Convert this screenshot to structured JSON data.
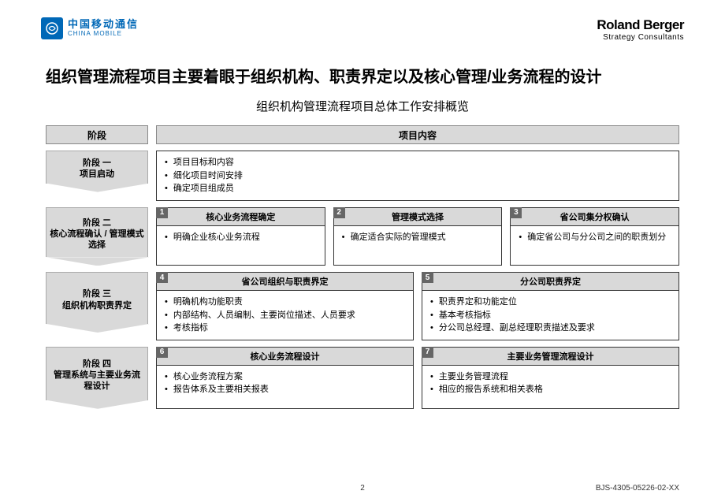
{
  "header": {
    "logo_cn": "中国移动通信",
    "logo_en": "CHINA MOBILE",
    "rb_name": "Roland Berger",
    "rb_sub": "Strategy Consultants"
  },
  "title": "组织管理流程项目主要着眼于组织机构、职责界定以及核心管理/业务流程的设计",
  "subtitle": "组织机构管理流程项目总体工作安排概览",
  "columns": {
    "phase": "阶段",
    "content": "项目内容"
  },
  "phases": [
    {
      "label": "阶段 一\n项目启动",
      "boxes": [
        {
          "num": "",
          "title": "",
          "items": [
            "项目目标和内容",
            "细化项目时间安排",
            "确定项目组成员"
          ]
        }
      ]
    },
    {
      "label": "阶段 二\n核心流程确认 / 管理模式选择",
      "boxes": [
        {
          "num": "1",
          "title": "核心业务流程确定",
          "items": [
            "明确企业核心业务流程"
          ]
        },
        {
          "num": "2",
          "title": "管理模式选择",
          "items": [
            "确定适合实际的管理模式"
          ]
        },
        {
          "num": "3",
          "title": "省公司集分权确认",
          "items": [
            "确定省公司与分公司之间的职责划分"
          ]
        }
      ]
    },
    {
      "label": "阶段 三\n组织机构职责界定",
      "boxes": [
        {
          "num": "4",
          "title": "省公司组织与职责界定",
          "items": [
            "明确机构功能职责",
            "内部结构、人员编制、主要岗位描述、人员要求",
            "考核指标"
          ]
        },
        {
          "num": "5",
          "title": "分公司职责界定",
          "items": [
            "职责界定和功能定位",
            "基本考核指标",
            "分公司总经理、副总经理职责描述及要求"
          ]
        }
      ]
    },
    {
      "label": "阶段 四\n管理系统与主要业务流程设计",
      "boxes": [
        {
          "num": "6",
          "title": "核心业务流程设计",
          "items": [
            "核心业务流程方案",
            "报告体系及主要相关报表"
          ]
        },
        {
          "num": "7",
          "title": "主要业务管理流程设计",
          "items": [
            "主要业务管理流程",
            "相应的报告系统和相关表格"
          ]
        }
      ]
    }
  ],
  "footer": {
    "page": "2",
    "code": "BJS-4305-05226-02-XX"
  }
}
